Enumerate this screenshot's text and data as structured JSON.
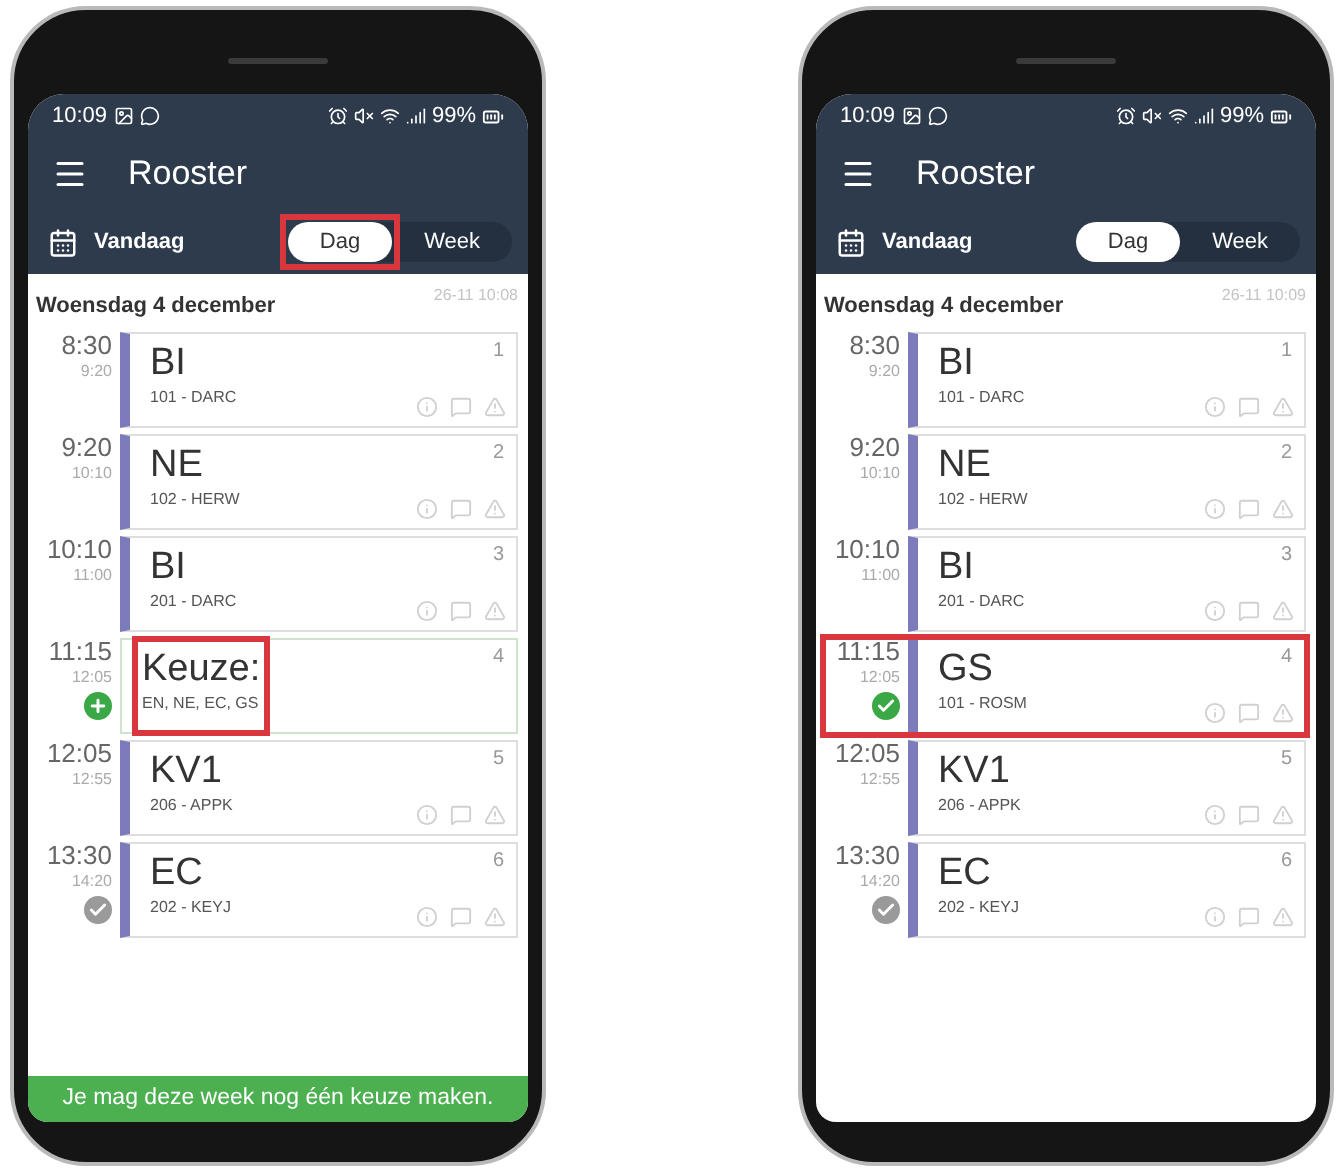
{
  "phones": [
    {
      "status_bar": {
        "time": "10:09",
        "battery": "99%"
      },
      "title": "Rooster",
      "today": "Vandaag",
      "view_options": [
        {
          "label": "Dag",
          "selected": true,
          "highlighted": true
        },
        {
          "label": "Week",
          "selected": false,
          "highlighted": false
        }
      ],
      "date": "Woensdag 4 december",
      "updated": "26-11 10:08",
      "lessons": [
        {
          "kind": "lesson",
          "start": "8:30",
          "end": "9:20",
          "subject": "BI",
          "detail": "101 - DARC",
          "number": "1"
        },
        {
          "kind": "lesson",
          "start": "9:20",
          "end": "10:10",
          "subject": "NE",
          "detail": "102 - HERW",
          "number": "2"
        },
        {
          "kind": "lesson",
          "start": "10:10",
          "end": "11:00",
          "subject": "BI",
          "detail": "201 - DARC",
          "number": "3"
        },
        {
          "kind": "choice",
          "start": "11:15",
          "end": "12:05",
          "subject": "Keuze:",
          "detail": "EN, NE, EC, GS",
          "number": "4",
          "status": {
            "kind": "add"
          },
          "highlight": {
            "kind": "title"
          }
        },
        {
          "kind": "lesson",
          "start": "12:05",
          "end": "12:55",
          "subject": "KV1",
          "detail": "206 - APPK",
          "number": "5"
        },
        {
          "kind": "lesson",
          "start": "13:30",
          "end": "14:20",
          "subject": "EC",
          "detail": "202 - KEYJ",
          "number": "6",
          "status": {
            "kind": "done"
          }
        }
      ],
      "banner": "Je mag deze week nog één keuze maken."
    },
    {
      "status_bar": {
        "time": "10:09",
        "battery": "99%"
      },
      "title": "Rooster",
      "today": "Vandaag",
      "view_options": [
        {
          "label": "Dag",
          "selected": true,
          "highlighted": false
        },
        {
          "label": "Week",
          "selected": false,
          "highlighted": false
        }
      ],
      "date": "Woensdag 4 december",
      "updated": "26-11 10:09",
      "lessons": [
        {
          "kind": "lesson",
          "start": "8:30",
          "end": "9:20",
          "subject": "BI",
          "detail": "101 - DARC",
          "number": "1"
        },
        {
          "kind": "lesson",
          "start": "9:20",
          "end": "10:10",
          "subject": "NE",
          "detail": "102 - HERW",
          "number": "2"
        },
        {
          "kind": "lesson",
          "start": "10:10",
          "end": "11:00",
          "subject": "BI",
          "detail": "201 - DARC",
          "number": "3"
        },
        {
          "kind": "lesson",
          "start": "11:15",
          "end": "12:05",
          "subject": "GS",
          "detail": "101 - ROSM",
          "number": "4",
          "status": {
            "kind": "chosen"
          },
          "highlight": {
            "kind": "row"
          }
        },
        {
          "kind": "lesson",
          "start": "12:05",
          "end": "12:55",
          "subject": "KV1",
          "detail": "206 - APPK",
          "number": "5"
        },
        {
          "kind": "lesson",
          "start": "13:30",
          "end": "14:20",
          "subject": "EC",
          "detail": "202 - KEYJ",
          "number": "6",
          "status": {
            "kind": "done"
          }
        }
      ]
    }
  ]
}
